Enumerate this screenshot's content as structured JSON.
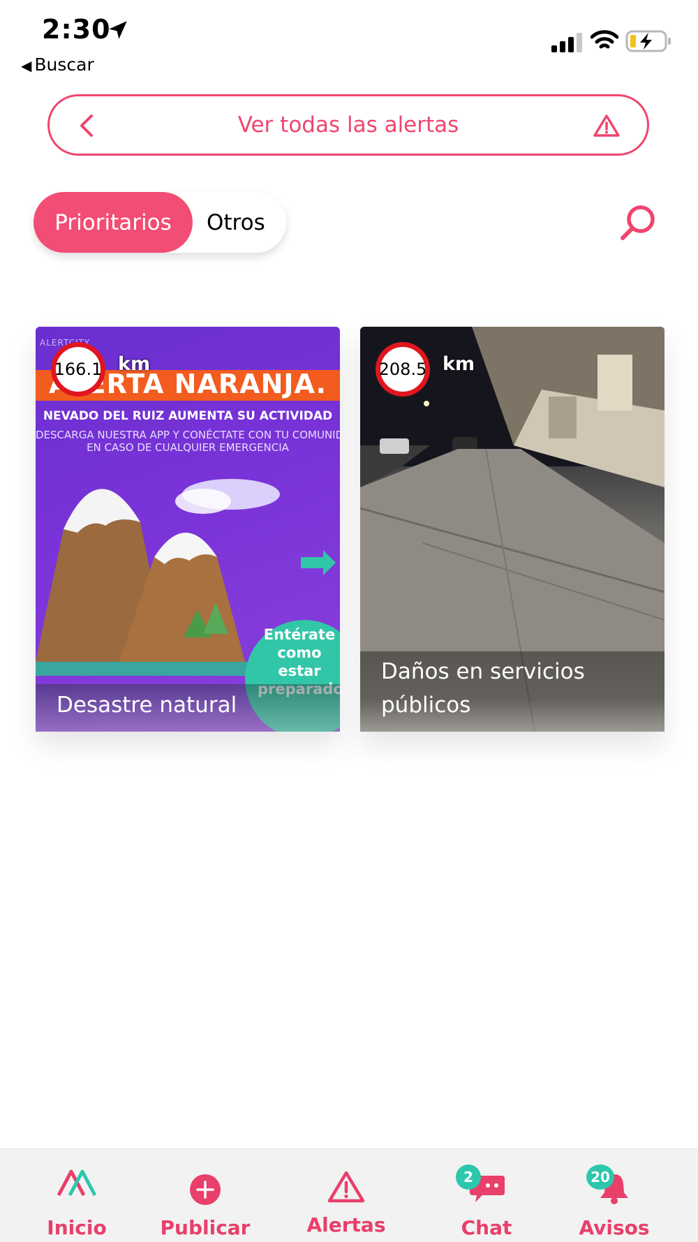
{
  "status_bar": {
    "time": "2:30",
    "back_label": "Buscar"
  },
  "banner": {
    "label": "Ver todas las alertas"
  },
  "filters": {
    "active": "Prioritarios",
    "other": "Otros"
  },
  "cards": [
    {
      "distance": "166.1",
      "unit": "km",
      "title": "Desastre natural",
      "artwork": {
        "brand": "ALERTCITY",
        "headline": "ALERTA NARANJA.",
        "subline1": "NEVADO DEL RUIZ AUMENTA SU ACTIVIDAD",
        "subline2": "DESCARGA NUESTRA APP Y CONÉCTATE CON TU COMUNIDAD",
        "subline3": "EN CASO DE CUALQUIER EMERGENCIA",
        "cta": "Entérate como estar preparado"
      }
    },
    {
      "distance": "208.5",
      "unit": "km",
      "title": "Daños en servicios públicos"
    }
  ],
  "tabbar": {
    "items": [
      {
        "label": "Inicio",
        "icon": "home-logo-icon"
      },
      {
        "label": "Publicar",
        "icon": "plus-circle-icon"
      },
      {
        "label": "Alertas",
        "icon": "warning-icon"
      },
      {
        "label": "Chat",
        "icon": "chat-icon",
        "badge": "2"
      },
      {
        "label": "Avisos",
        "icon": "bell-icon",
        "badge": "20"
      }
    ]
  },
  "colors": {
    "accent": "#f0456f",
    "badge": "#2cc7ac"
  }
}
